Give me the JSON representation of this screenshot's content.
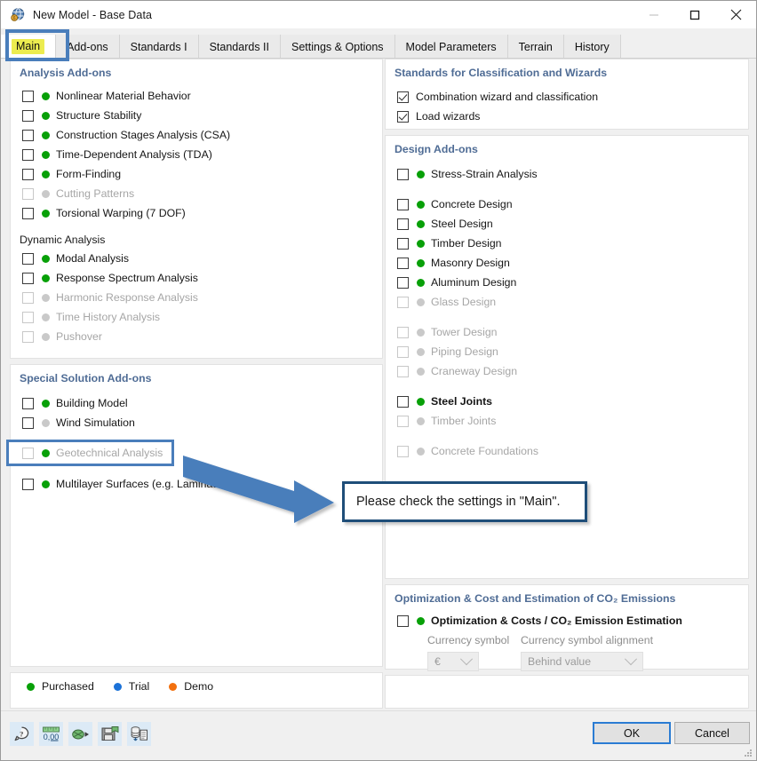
{
  "window": {
    "title": "New Model - Base Data",
    "app_icon": "globe-model-icon",
    "minimize": "minimize-icon",
    "maximize": "maximize-icon",
    "close": "close-icon"
  },
  "tabs": [
    {
      "label": "Main",
      "active": true
    },
    {
      "label": "Add-ons",
      "active": false
    },
    {
      "label": "Standards I",
      "active": false
    },
    {
      "label": "Standards II",
      "active": false
    },
    {
      "label": "Settings & Options",
      "active": false
    },
    {
      "label": "Model Parameters",
      "active": false
    },
    {
      "label": "Terrain",
      "active": false
    },
    {
      "label": "History",
      "active": false
    }
  ],
  "left": {
    "analysis_addons": {
      "title": "Analysis Add-ons",
      "items": [
        {
          "label": "Nonlinear Material Behavior",
          "checked": false,
          "enabled": true,
          "status": "green"
        },
        {
          "label": "Structure Stability",
          "checked": false,
          "enabled": true,
          "status": "green"
        },
        {
          "label": "Construction Stages Analysis (CSA)",
          "checked": false,
          "enabled": true,
          "status": "green"
        },
        {
          "label": "Time-Dependent Analysis (TDA)",
          "checked": false,
          "enabled": true,
          "status": "green"
        },
        {
          "label": "Form-Finding",
          "checked": false,
          "enabled": true,
          "status": "green"
        },
        {
          "label": "Cutting Patterns",
          "checked": false,
          "enabled": false,
          "status": "gray"
        },
        {
          "label": "Torsional Warping (7 DOF)",
          "checked": false,
          "enabled": true,
          "status": "green"
        }
      ],
      "subgroup_title": "Dynamic Analysis",
      "dynamic_items": [
        {
          "label": "Modal Analysis",
          "checked": false,
          "enabled": true,
          "status": "green"
        },
        {
          "label": "Response Spectrum Analysis",
          "checked": false,
          "enabled": true,
          "status": "green"
        },
        {
          "label": "Harmonic Response Analysis",
          "checked": false,
          "enabled": false,
          "status": "gray"
        },
        {
          "label": "Time History Analysis",
          "checked": false,
          "enabled": false,
          "status": "gray"
        },
        {
          "label": "Pushover",
          "checked": false,
          "enabled": false,
          "status": "gray"
        }
      ]
    },
    "special_addons": {
      "title": "Special Solution Add-ons",
      "items": [
        {
          "label": "Building Model",
          "checked": false,
          "enabled": true,
          "status": "green"
        },
        {
          "label": "Wind Simulation",
          "checked": false,
          "enabled": true,
          "status": "gray"
        }
      ],
      "highlighted": {
        "label": "Geotechnical Analysis",
        "checked": false,
        "enabled": false,
        "status": "green"
      },
      "items_after": [
        {
          "label": "Multilayer Surfaces (e.g. Laminate, CLT)",
          "checked": false,
          "enabled": true,
          "status": "green"
        }
      ]
    },
    "legend": [
      {
        "label": "Purchased",
        "status": "green"
      },
      {
        "label": "Trial",
        "status": "blue"
      },
      {
        "label": "Demo",
        "status": "orange"
      }
    ]
  },
  "right": {
    "standards": {
      "title": "Standards for Classification and Wizards",
      "items": [
        {
          "label": "Combination wizard and classification",
          "checked": true,
          "enabled": true
        },
        {
          "label": "Load wizards",
          "checked": true,
          "enabled": true
        }
      ]
    },
    "design_addons": {
      "title": "Design Add-ons",
      "group1": [
        {
          "label": "Stress-Strain Analysis",
          "checked": false,
          "enabled": true,
          "status": "green"
        }
      ],
      "group2": [
        {
          "label": "Concrete Design",
          "checked": false,
          "enabled": true,
          "status": "green"
        },
        {
          "label": "Steel Design",
          "checked": false,
          "enabled": true,
          "status": "green"
        },
        {
          "label": "Timber Design",
          "checked": false,
          "enabled": true,
          "status": "green"
        },
        {
          "label": "Masonry Design",
          "checked": false,
          "enabled": true,
          "status": "green"
        },
        {
          "label": "Aluminum Design",
          "checked": false,
          "enabled": true,
          "status": "green"
        },
        {
          "label": "Glass Design",
          "checked": false,
          "enabled": false,
          "status": "gray"
        }
      ],
      "group3": [
        {
          "label": "Tower Design",
          "checked": false,
          "enabled": false,
          "status": "gray"
        },
        {
          "label": "Piping Design",
          "checked": false,
          "enabled": false,
          "status": "gray"
        },
        {
          "label": "Craneway Design",
          "checked": false,
          "enabled": false,
          "status": "gray"
        }
      ],
      "group4": [
        {
          "label": "Steel Joints",
          "checked": false,
          "enabled": true,
          "status": "green"
        },
        {
          "label": "Timber Joints",
          "checked": false,
          "enabled": false,
          "status": "gray"
        }
      ],
      "group5": [
        {
          "label": "Concrete Foundations",
          "checked": false,
          "enabled": false,
          "status": "gray"
        }
      ]
    },
    "optimization": {
      "title": "Optimization & Cost and Estimation of CO₂ Emissions",
      "checkbox": {
        "label": "Optimization & Costs / CO₂ Emission Estimation",
        "checked": false,
        "enabled": true,
        "status": "green"
      },
      "currency_symbol_label": "Currency symbol",
      "currency_symbol_value": "€",
      "currency_alignment_label": "Currency symbol alignment",
      "currency_alignment_value": "Behind value"
    }
  },
  "annotation": {
    "callout_text": "Please check the settings in \"Main\".",
    "arrow_color": "#4a7ebb",
    "highlight_color": "#4a7ebb",
    "callout_border_color": "#1f4e79",
    "tab_highlight_color": "#ecec4f"
  },
  "footer": {
    "tools": [
      {
        "name": "help-icon"
      },
      {
        "name": "units-icon"
      },
      {
        "name": "apply-icon"
      },
      {
        "name": "save-template-icon"
      },
      {
        "name": "load-template-icon"
      }
    ],
    "ok_label": "OK",
    "cancel_label": "Cancel",
    "resize_grip": "resize-grip-icon"
  }
}
